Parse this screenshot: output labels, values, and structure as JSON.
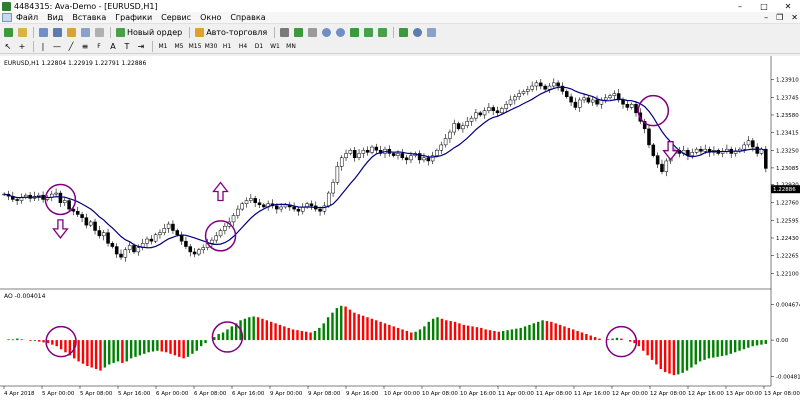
{
  "window": {
    "title": "4484315: Ava-Demo - [EURUSD,H1]",
    "controls": [
      "–",
      "□",
      "✕"
    ]
  },
  "menu": {
    "items": [
      "Файл",
      "Вид",
      "Вставка",
      "Графики",
      "Сервис",
      "Окно",
      "Справка"
    ],
    "mdi_controls": [
      "–",
      "❐",
      "✕"
    ]
  },
  "toolbar": {
    "new_order_label": "Новый ордер",
    "autotrading_label": "Авто-торговля",
    "timeframes": [
      "M1",
      "M5",
      "M15",
      "M30",
      "H1",
      "H4",
      "D1",
      "W1",
      "MN"
    ]
  },
  "colors": {
    "bull": "#ffffff",
    "bear": "#000000",
    "ma": "#000080",
    "ao_up": "#008000",
    "ao_down": "#ff0000",
    "annotation": "#800080",
    "current_price_bg": "#000000"
  },
  "chart": {
    "symbol_label": "EURUSD,H1  1.22804 1.22919 1.22791 1.22886",
    "price_ticks": [
      "1.23910",
      "1.23745",
      "1.23580",
      "1.23415",
      "1.23250",
      "1.23085",
      "1.22930",
      "1.22760",
      "1.22595",
      "1.22430",
      "1.22265",
      "1.22100"
    ],
    "current_price": "1.22886",
    "ao_label": "AO -0.004014",
    "ao_ticks": [
      "0.004674",
      "0.00",
      "-0.00481"
    ],
    "time_labels": [
      "4 Apr 2018",
      "5 Apr 00:00",
      "5 Apr 08:00",
      "5 Apr 16:00",
      "6 Apr 00:00",
      "6 Apr 08:00",
      "6 Apr 16:00",
      "9 Apr 00:00",
      "9 Apr 08:00",
      "9 Apr 16:00",
      "10 Apr 00:00",
      "10 Apr 08:00",
      "10 Apr 16:00",
      "11 Apr 00:00",
      "11 Apr 08:00",
      "11 Apr 16:00",
      "12 Apr 00:00",
      "12 Apr 08:00",
      "12 Apr 16:00",
      "13 Apr 00:00",
      "13 Apr 08:00"
    ]
  },
  "chart_data": {
    "type": "candlestick",
    "title": "EURUSD,H1",
    "ylim": [
      1.22,
      1.24
    ],
    "close": [
      1.2284,
      1.2282,
      1.2279,
      1.2278,
      1.2281,
      1.2283,
      1.228,
      1.2282,
      1.2283,
      1.2279,
      1.2281,
      1.2284,
      1.2285,
      1.2276,
      1.2278,
      1.227,
      1.2268,
      1.2265,
      1.2262,
      1.2255,
      1.2258,
      1.225,
      1.2245,
      1.2248,
      1.2238,
      1.2235,
      1.2228,
      1.2225,
      1.2232,
      1.2236,
      1.223,
      1.2234,
      1.2238,
      1.2242,
      1.224,
      1.2246,
      1.2248,
      1.2252,
      1.2256,
      1.225,
      1.2246,
      1.224,
      1.2235,
      1.223,
      1.2228,
      1.2232,
      1.2234,
      1.2238,
      1.2241,
      1.2245,
      1.225,
      1.2254,
      1.2258,
      1.2264,
      1.227,
      1.2275,
      1.2278,
      1.228,
      1.2276,
      1.2274,
      1.2272,
      1.2275,
      1.2273,
      1.227,
      1.2272,
      1.2274,
      1.2272,
      1.227,
      1.2268,
      1.2272,
      1.2275,
      1.2273,
      1.227,
      1.2268,
      1.2273,
      1.2285,
      1.2295,
      1.231,
      1.2318,
      1.2322,
      1.2325,
      1.2318,
      1.2322,
      1.2325,
      1.2323,
      1.2328,
      1.2325,
      1.2322,
      1.2326,
      1.2322,
      1.232,
      1.2322,
      1.2318,
      1.2316,
      1.232,
      1.2322,
      1.2316,
      1.2318,
      1.2315,
      1.232,
      1.2325,
      1.233,
      1.2336,
      1.2342,
      1.235,
      1.2345,
      1.2348,
      1.2352,
      1.2355,
      1.236,
      1.2358,
      1.2362,
      1.2365,
      1.2362,
      1.236,
      1.2364,
      1.2368,
      1.2372,
      1.2375,
      1.2378,
      1.238,
      1.2382,
      1.2385,
      1.2388,
      1.2385,
      1.2382,
      1.2385,
      1.2388,
      1.2385,
      1.238,
      1.2375,
      1.237,
      1.2365,
      1.2372,
      1.2374,
      1.237,
      1.2372,
      1.2368,
      1.2372,
      1.2374,
      1.2376,
      1.2378,
      1.2372,
      1.2368,
      1.2365,
      1.2368,
      1.236,
      1.2352,
      1.2345,
      1.233,
      1.232,
      1.2312,
      1.2305,
      1.2315,
      1.2322,
      1.2325,
      1.2322,
      1.2325,
      1.232,
      1.2323,
      1.2326,
      1.2324,
      1.2326,
      1.2323,
      1.2325,
      1.2322,
      1.2324,
      1.2326,
      1.2322,
      1.2324,
      1.2326,
      1.233,
      1.2334,
      1.2328,
      1.2322,
      1.2326,
      1.2308
    ],
    "ao": [
      0.0,
      0.0001,
      0.0001,
      0.0002,
      0.0001,
      0.0,
      -0.0001,
      -0.0001,
      -0.0002,
      -0.0003,
      -0.0004,
      -0.0006,
      -0.0008,
      -0.0012,
      -0.0016,
      -0.002,
      -0.0024,
      -0.0028,
      -0.0031,
      -0.0034,
      -0.0036,
      -0.0038,
      -0.004,
      -0.0036,
      -0.0032,
      -0.003,
      -0.0028,
      -0.003,
      -0.0028,
      -0.0024,
      -0.0022,
      -0.002,
      -0.0018,
      -0.0016,
      -0.0015,
      -0.0014,
      -0.0015,
      -0.0016,
      -0.0018,
      -0.002,
      -0.0022,
      -0.0024,
      -0.0022,
      -0.0018,
      -0.0014,
      -0.0008,
      -0.0004,
      0.0,
      0.0004,
      0.0008,
      0.001,
      0.0014,
      0.0018,
      0.0022,
      0.0026,
      0.0028,
      0.003,
      0.0031,
      0.003,
      0.0028,
      0.0026,
      0.0024,
      0.0022,
      0.002,
      0.0018,
      0.0016,
      0.0014,
      0.0013,
      0.0012,
      0.0011,
      0.001,
      0.0012,
      0.0016,
      0.0022,
      0.003,
      0.0036,
      0.0042,
      0.0045,
      0.0044,
      0.004,
      0.0036,
      0.0034,
      0.0032,
      0.003,
      0.0028,
      0.0026,
      0.0024,
      0.0022,
      0.002,
      0.0018,
      0.0016,
      0.0014,
      0.0012,
      0.001,
      0.0011,
      0.0014,
      0.0018,
      0.0024,
      0.0028,
      0.003,
      0.0028,
      0.0026,
      0.0025,
      0.0024,
      0.0022,
      0.002,
      0.0019,
      0.0018,
      0.0017,
      0.0016,
      0.0014,
      0.0013,
      0.0012,
      0.0011,
      0.0012,
      0.0013,
      0.0014,
      0.0015,
      0.0016,
      0.0018,
      0.002,
      0.0022,
      0.0024,
      0.0026,
      0.0025,
      0.0024,
      0.0022,
      0.002,
      0.0018,
      0.0016,
      0.0014,
      0.0012,
      0.001,
      0.0008,
      0.0006,
      0.0004,
      0.0002,
      0.0,
      0.0001,
      0.0002,
      0.0003,
      0.0002,
      0.0,
      -0.0002,
      -0.0004,
      -0.0008,
      -0.0014,
      -0.002,
      -0.0026,
      -0.0032,
      -0.0038,
      -0.0042,
      -0.0044,
      -0.0046,
      -0.0045,
      -0.0043,
      -0.004,
      -0.0036,
      -0.0032,
      -0.0028,
      -0.0026,
      -0.0024,
      -0.0023,
      -0.0022,
      -0.0021,
      -0.002,
      -0.0018,
      -0.0016,
      -0.0014,
      -0.0012,
      -0.001,
      -0.0008,
      -0.0007,
      -0.0006,
      -0.0005
    ],
    "ao_ylim": [
      -0.0055,
      0.005
    ],
    "annotations": [
      {
        "type": "circle",
        "bar": 13,
        "price": 1.2279
      },
      {
        "type": "circle",
        "bar": 50,
        "price": 1.2245
      },
      {
        "type": "circle",
        "bar": 150,
        "price": 1.2362
      },
      {
        "type": "circle",
        "ao_bar": 13,
        "ao": -0.0002
      },
      {
        "type": "circle",
        "ao_bar": 51,
        "ao": 0.0004
      },
      {
        "type": "circle",
        "ao_bar": 141,
        "ao": -0.0002
      },
      {
        "type": "arrow-down",
        "bar": 13,
        "price": 1.2245
      },
      {
        "type": "arrow-up",
        "bar": 50,
        "price": 1.2293
      },
      {
        "type": "arrow-down",
        "bar": 154,
        "price": 1.2318
      }
    ]
  }
}
